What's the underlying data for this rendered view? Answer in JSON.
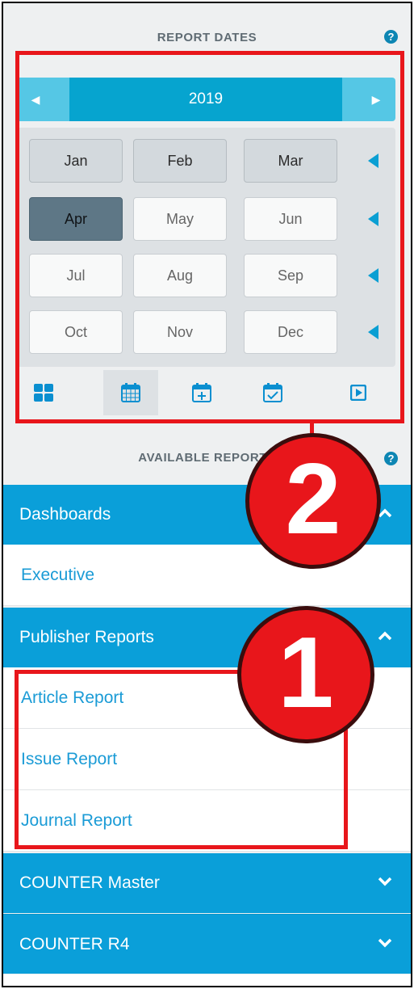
{
  "report_dates": {
    "heading": "REPORT DATES",
    "help_glyph": "?",
    "year": "2019",
    "prev_icon": "caret-left-icon",
    "next_icon": "caret-right-icon",
    "months": [
      "Jan",
      "Feb",
      "Mar",
      "Apr",
      "May",
      "Jun",
      "Jul",
      "Aug",
      "Sep",
      "Oct",
      "Nov",
      "Dec"
    ],
    "highlighted_months": [
      "Jan",
      "Feb",
      "Mar"
    ],
    "selected_month": "Apr",
    "toolbar_icons": [
      "dashboard-grid-icon",
      "calendar-month-icon",
      "calendar-add-icon",
      "calendar-check-icon",
      "play-box-icon"
    ],
    "active_tool": "calendar-month-icon"
  },
  "available_reports": {
    "heading": "AVAILABLE REPORTS",
    "help_glyph": "?",
    "sections": [
      {
        "label": "Dashboards",
        "expanded": true,
        "items": [
          "Executive"
        ]
      },
      {
        "label": "Publisher Reports",
        "expanded": true,
        "items": [
          "Article Report",
          "Issue Report",
          "Journal Report"
        ]
      },
      {
        "label": "COUNTER Master",
        "expanded": false,
        "items": []
      },
      {
        "label": "COUNTER R4",
        "expanded": false,
        "items": []
      }
    ]
  },
  "annotations": {
    "badge_1": "1",
    "badge_2": "2"
  },
  "colors": {
    "accent": "#0a9fd9",
    "link": "#1a9bd6",
    "annotation_red": "#e8161b",
    "selected_month": "#5e7786"
  }
}
